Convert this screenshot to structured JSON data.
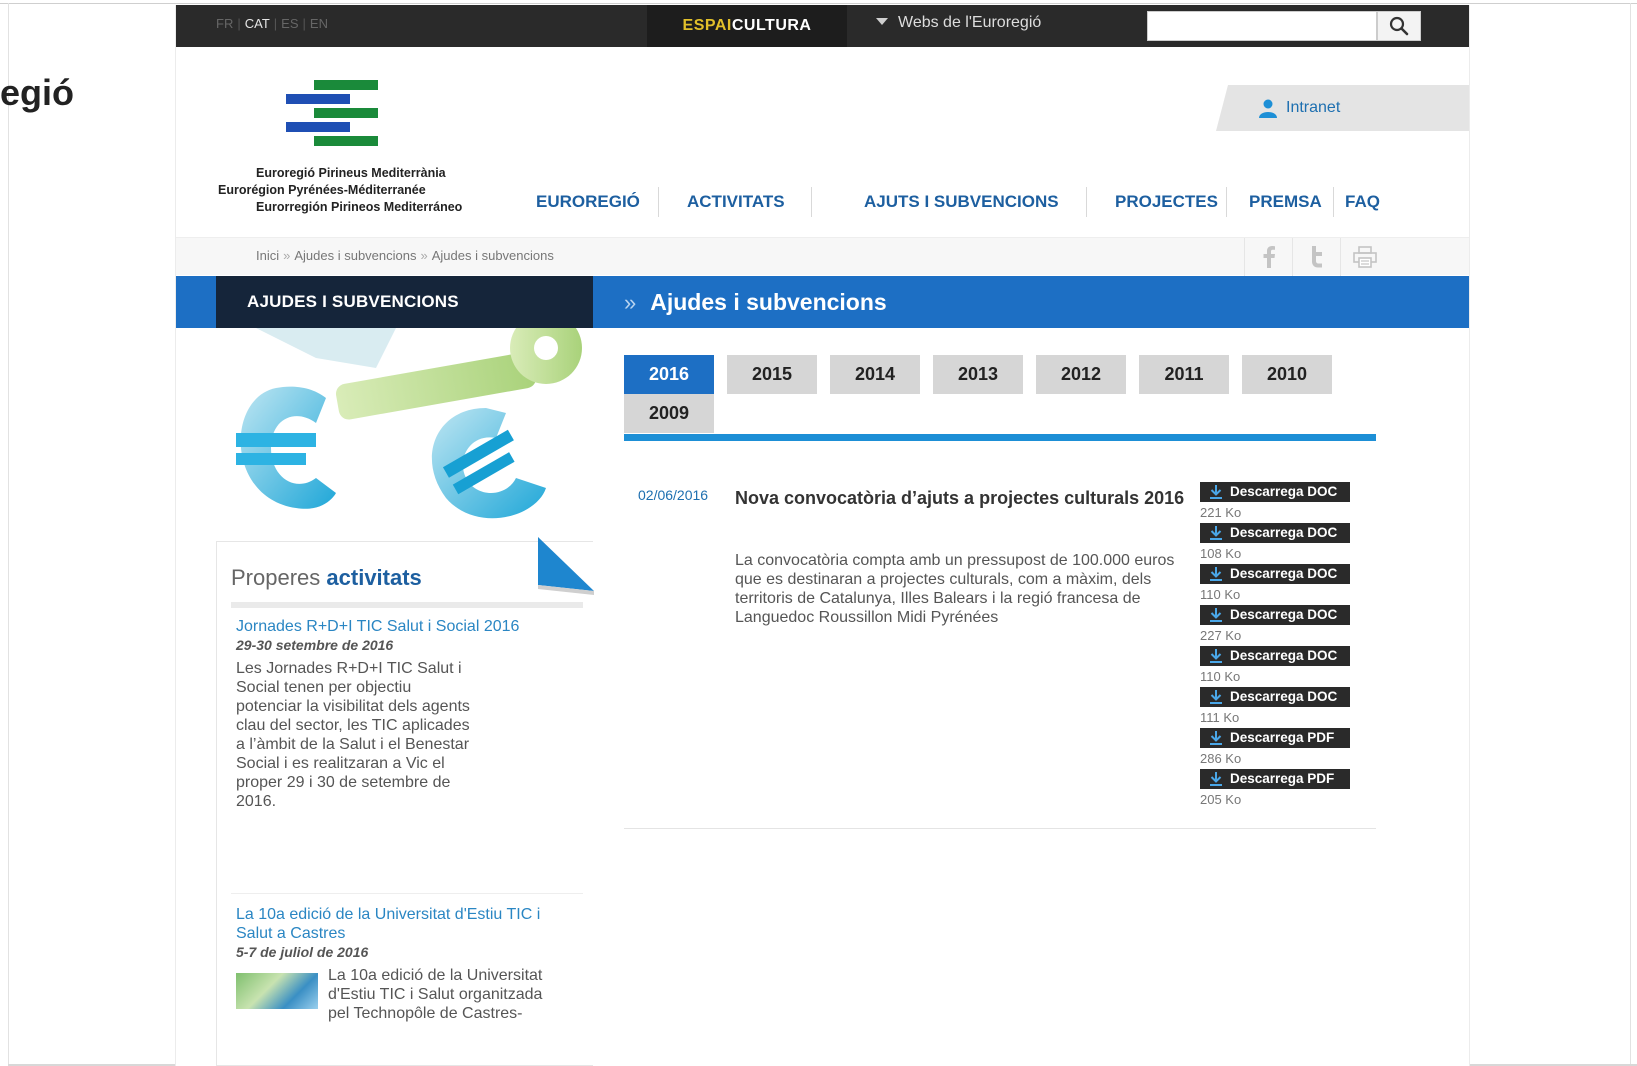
{
  "outer": {
    "title_fragment": "egió"
  },
  "topbar": {
    "langs": [
      "FR",
      "CAT",
      "ES",
      "EN"
    ],
    "active_lang": "CAT",
    "espai_1": "ESPAI",
    "espai_2": "CULTURA",
    "webs": "Webs de l'Euroregió",
    "search_placeholder": ""
  },
  "header": {
    "logo_lines": [
      "Euroregió Pirineus Mediterrània",
      "Eurorégion Pyrénées-Méditerranée",
      "Eurorregión Pirineos Mediterráneo"
    ],
    "intranet": "Intranet",
    "nav": [
      "EUROREGIÓ",
      "ACTIVITATS",
      "AJUTS I SUBVENCIONS",
      "PROJECTES",
      "PREMSA",
      "FAQ"
    ]
  },
  "breadcrumb": [
    "Inici",
    "Ajudes i subvencions",
    "Ajudes i subvencions"
  ],
  "breadcrumb_sep": "»",
  "section": {
    "left_title": "AJUDES I SUBVENCIONS",
    "title": "Ajudes i subvencions",
    "arrows": "»"
  },
  "years": [
    "2016",
    "2015",
    "2014",
    "2013",
    "2012",
    "2011",
    "2010",
    "2009"
  ],
  "active_year": "2016",
  "entry": {
    "date": "02/06/2016",
    "title": "Nova convocatòria d’ajuts a projectes culturals 2016",
    "description": "La convocatòria compta amb un pressupost de 100.000 euros que es destinaran a projectes culturals, com a màxim, dels territoris de Catalunya, Illes Balears i la regió francesa de Languedoc Roussillon Midi Pyrénées",
    "downloads": [
      {
        "label": "Descarrega DOC",
        "size": "221 Ko"
      },
      {
        "label": "Descarrega DOC",
        "size": "108 Ko"
      },
      {
        "label": "Descarrega DOC",
        "size": "110 Ko"
      },
      {
        "label": "Descarrega DOC",
        "size": "227 Ko"
      },
      {
        "label": "Descarrega DOC",
        "size": "110 Ko"
      },
      {
        "label": "Descarrega DOC",
        "size": "111 Ko"
      },
      {
        "label": "Descarrega PDF",
        "size": "286 Ko"
      },
      {
        "label": "Descarrega PDF",
        "size": "205 Ko"
      }
    ]
  },
  "properes": {
    "title_1": "Properes",
    "title_2": "activitats",
    "events": [
      {
        "title": "Jornades R+D+I TIC Salut i Social 2016",
        "date": "29-30 setembre de 2016",
        "text": "Les Jornades R+D+I TIC Salut i Social tenen per objectiu potenciar la visibilitat dels agents clau del sector, les TIC aplicades a l’àmbit de la Salut i el Benestar Social i es realitzaran a Vic el proper 29 i 30 de setembre de 2016."
      },
      {
        "title": "La 10a edició de la Universitat d'Estiu TIC i Salut a Castres",
        "date": "5-7 de juliol de 2016",
        "text": "La 10a edició de la Universitat d'Estiu TIC i Salut organitzada pel Technopôle de Castres-"
      }
    ]
  },
  "colors": {
    "brand_blue": "#1d6fc4",
    "dark_bar": "#2a2a2a",
    "accent_yellow": "#e2c02a",
    "link_blue": "#1d5fa0"
  }
}
